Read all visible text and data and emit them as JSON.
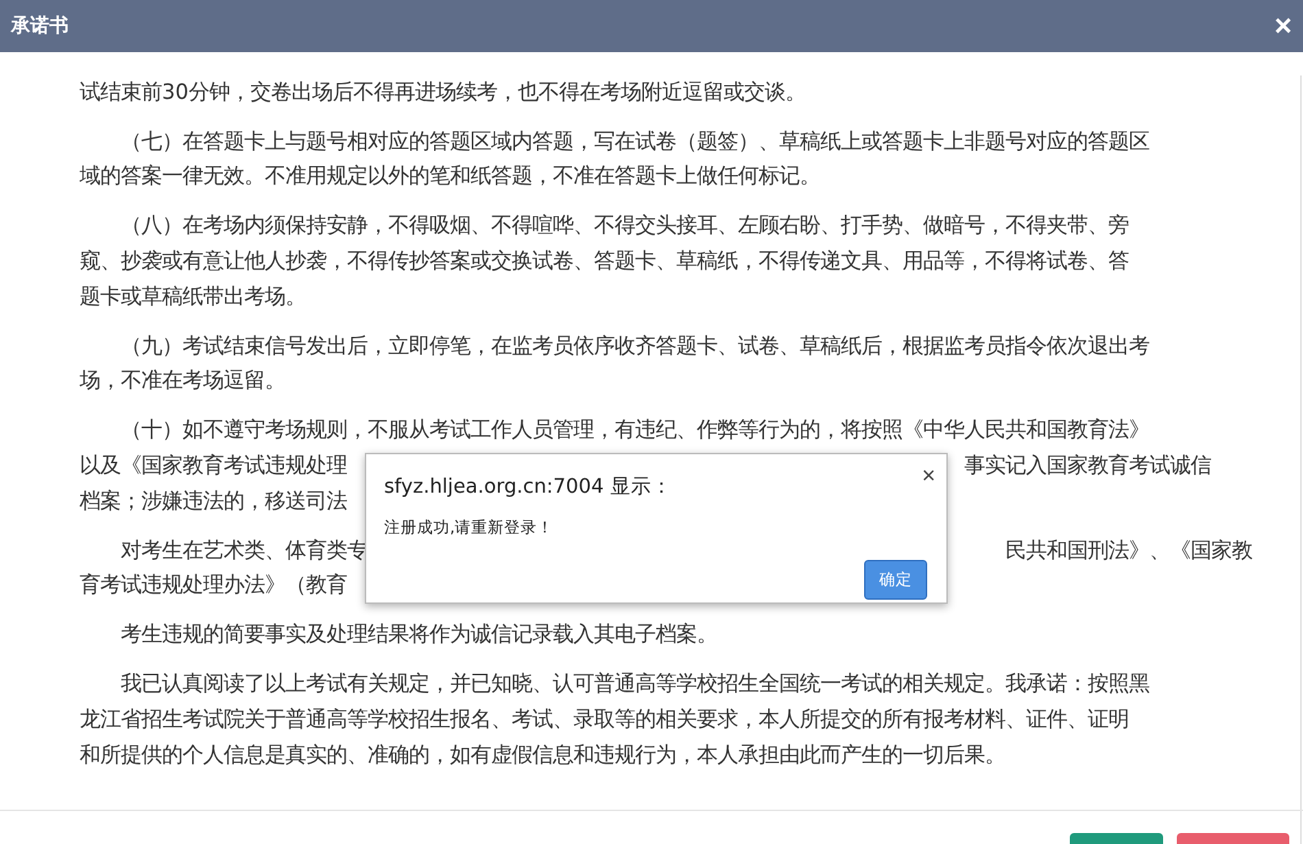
{
  "window": {
    "title": "承诺书",
    "close": "×"
  },
  "paragraphs": [
    {
      "continued": true,
      "lines": [
        {
          "text": "试结束前30分钟，交卷出场后不得再进场续考，也不得在考场附近逗留或交谈。"
        }
      ]
    },
    {
      "lines": [
        {
          "text": "（七）在答题卡上与题号相对应的答题区域内答题，写在试卷（题签）、草稿纸上或答题卡上非题号对应的答题区"
        },
        {
          "text": "域的答案一律无效。不准用规定以外的笔和纸答题，不准在答题卡上做任何标记。"
        }
      ]
    },
    {
      "lines": [
        {
          "text": "（八）在考场内须保持安静，不得吸烟、不得喧哗、不得交头接耳、左顾右盼、打手势、做暗号，不得夹带、旁"
        },
        {
          "text": "窥、抄袭或有意让他人抄袭，不得传抄答案或交换试卷、答题卡、草稿纸，不得传递文具、用品等，不得将试卷、答"
        },
        {
          "text": "题卡或草稿纸带出考场。"
        }
      ]
    },
    {
      "lines": [
        {
          "text": "（九）考试结束信号发出后，立即停笔，在监考员依序收齐答题卡、试卷、草稿纸后，根据监考员指令依次退出考"
        },
        {
          "text": "场，不准在考场逗留。"
        }
      ]
    },
    {
      "lines": [
        {
          "text": "（十）如不遵守考场规则，不服从考试工作人员管理，有违纪、作弊等行为的，将按照《中华人民共和国教育法》"
        },
        {
          "text": "以及《国家教育考试违规处理",
          "right": "事实记入国家教育考试诚信"
        },
        {
          "text": "档案；涉嫌违法的，移送司法"
        }
      ]
    },
    {
      "lines": [
        {
          "text": "对考生在艺术类、体育类专",
          "right": "民共和国刑法》、《国家教"
        },
        {
          "text": "育考试违规处理办法》（教育"
        }
      ]
    },
    {
      "lines": [
        {
          "text": "考生违规的简要事实及处理结果将作为诚信记录载入其电子档案。"
        }
      ]
    },
    {
      "lines": [
        {
          "text": "我已认真阅读了以上考试有关规定，并已知晓、认可普通高等学校招生全国统一考试的相关规定。我承诺：按照黑"
        },
        {
          "text": "龙江省招生考试院关于普通高等学校招生报名、考试、录取等的相关要求，本人所提交的所有报考材料、证件、证明"
        },
        {
          "text": "和所提供的个人信息是真实的、准确的，如有虚假信息和违规行为，本人承担由此而产生的一切后果。"
        }
      ]
    }
  ],
  "alert": {
    "title": "sfyz.hljea.org.cn:7004 显示：",
    "close": "×",
    "message": "注册成功,请重新登录！",
    "button": "确定"
  }
}
